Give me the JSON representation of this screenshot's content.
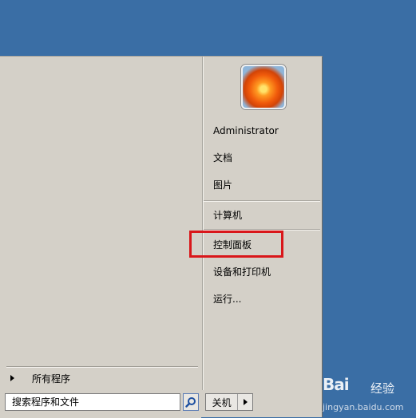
{
  "start_menu": {
    "all_programs": "所有程序",
    "search_placeholder": "搜索程序和文件",
    "user_name": "Administrator",
    "right_items": [
      "文档",
      "图片",
      "计算机",
      "控制面板",
      "设备和打印机",
      "运行..."
    ],
    "shutdown_label": "关机",
    "highlight_color": "#d9161a"
  },
  "watermark": {
    "logo": "Bai",
    "text": "经验",
    "url": "jingyan.baidu.com"
  }
}
